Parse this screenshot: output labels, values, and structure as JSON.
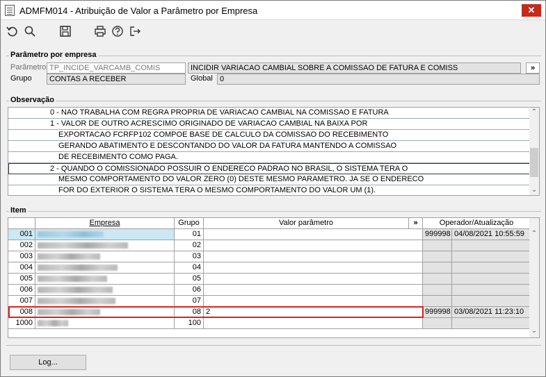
{
  "window": {
    "title": "ADMFM014 - Atribuição de Valor a Parâmetro por Empresa",
    "close_glyph": "✕"
  },
  "toolbar": {
    "icons": [
      "undo-icon",
      "search-icon",
      "save-icon",
      "print-icon",
      "help-icon",
      "exit-icon"
    ]
  },
  "param": {
    "section_title": "Parâmetro por empresa",
    "param_label": "Parâmetro",
    "param_value": "TP_INCIDE_VARCAMB_COMIS",
    "param_desc": "INCIDIR VARIACAO CAMBIAL SOBRE A COMISSAO DE FATURA E COMISS",
    "expand_label": "»",
    "grupo_label": "Grupo",
    "grupo_value": "CONTAS A RECEBER",
    "global_label": "Global",
    "global_value": "0"
  },
  "obs": {
    "section_title": "Observação",
    "lines": [
      "0 - NAO TRABALHA COM REGRA PROPRIA DE VARIACAO CAMBIAL NA COMISSAO E FATURA",
      "1 - VALOR DE OUTRO ACRESCIMO ORIGINADO DE VARIACAO CAMBIAL NA BAIXA POR",
      "EXPORTACAO FCRFP102 COMPOE BASE DE CALCULO DA COMISSAO DO RECEBIMENTO",
      "GERANDO ABATIMENTO E DESCONTANDO DO VALOR DA FATURA MANTENDO A COMISSAO",
      "DE RECEBIMENTO COMO PAGA.",
      "2 - QUANDO O COMISSIONADO POSSUIR O ENDERECO PADRAO NO BRASIL, O SISTEMA TERA O",
      "MESMO COMPORTAMENTO DO VALOR ZERO (0) DESTE MESMO PARAMETRO. JA SE O ENDERECO",
      "FOR DO EXTERIOR O SISTEMA TERA O MESMO COMPORTAMENTO DO VALOR UM (1)."
    ]
  },
  "item": {
    "section_title": "Item",
    "headers": {
      "empresa": "Empresa",
      "grupo": "Grupo",
      "valor": "Valor parâmetro",
      "expand": "»",
      "operador": "Operador/Atualização"
    },
    "rows": [
      {
        "code": "001",
        "grupo": "01",
        "valor": "",
        "operador": "999998",
        "data": "04/08/2021 10:55:59"
      },
      {
        "code": "002",
        "grupo": "02",
        "valor": "",
        "operador": "",
        "data": ""
      },
      {
        "code": "003",
        "grupo": "03",
        "valor": "",
        "operador": "",
        "data": ""
      },
      {
        "code": "004",
        "grupo": "04",
        "valor": "",
        "operador": "",
        "data": ""
      },
      {
        "code": "005",
        "grupo": "05",
        "valor": "",
        "operador": "",
        "data": ""
      },
      {
        "code": "006",
        "grupo": "06",
        "valor": "",
        "operador": "",
        "data": ""
      },
      {
        "code": "007",
        "grupo": "07",
        "valor": "",
        "operador": "",
        "data": ""
      },
      {
        "code": "008",
        "grupo": "08",
        "valor": "2",
        "operador": "999998",
        "data": "03/08/2021 11:23:10"
      },
      {
        "code": "1000",
        "grupo": "100",
        "valor": "",
        "operador": "",
        "data": ""
      }
    ]
  },
  "buttons": {
    "log": "Log..."
  },
  "colors": {
    "close": "#c42b1c",
    "selected_row": "#cce8f4",
    "highlight": "#e02020"
  }
}
